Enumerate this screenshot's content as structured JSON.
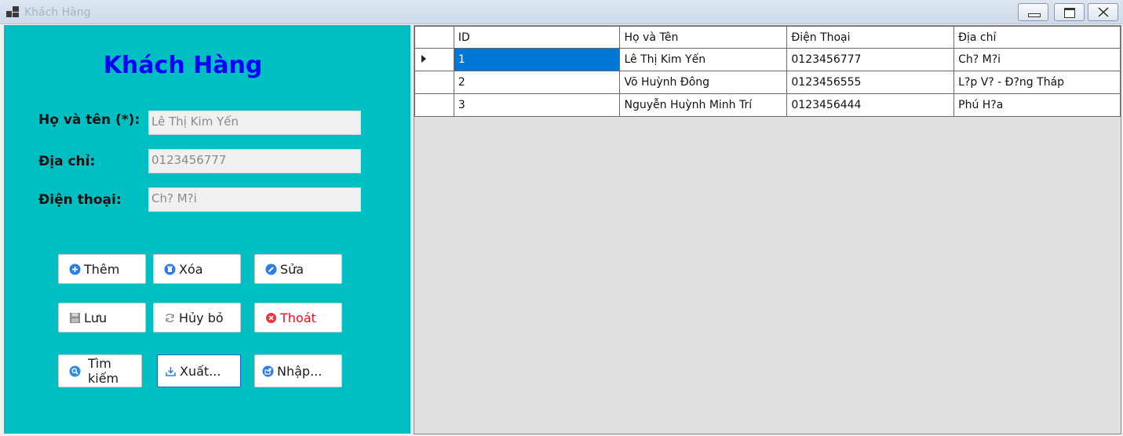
{
  "window": {
    "title": "Khách Hàng"
  },
  "form": {
    "heading": "Khách Hàng",
    "fields": [
      {
        "label": "Họ và tên (*):",
        "value": "Lê Thị Kim Yến"
      },
      {
        "label": "Địa chỉ:",
        "value": "0123456777"
      },
      {
        "label": "Điện thoại:",
        "value": "Ch? M?i"
      }
    ],
    "buttons": {
      "add": "Thêm",
      "delete": "Xóa",
      "edit": "Sửa",
      "save": "Lưu",
      "cancel": "Hủy bỏ",
      "exit": "Thoát",
      "search": "Tìm kiếm",
      "export": "Xuất...",
      "import": "Nhập..."
    }
  },
  "grid": {
    "columns": [
      "ID",
      "Họ và Tên",
      "Điện Thoại",
      "Địa chỉ"
    ],
    "rows": [
      [
        "1",
        "Lê Thị Kim Yến",
        "0123456777",
        "Ch? M?i"
      ],
      [
        "2",
        "Võ Huỳnh Đông",
        "0123456555",
        "L?p V? - Đ?ng Tháp"
      ],
      [
        "3",
        "Nguyễn Huỳnh Minh Trí",
        "0123456444",
        "Phú H?a"
      ]
    ],
    "selected_row": 0
  },
  "colors": {
    "panel": "#00bfc2",
    "heading": "#0b00ff",
    "exit_text": "#e81123",
    "selection": "#0078d7"
  }
}
